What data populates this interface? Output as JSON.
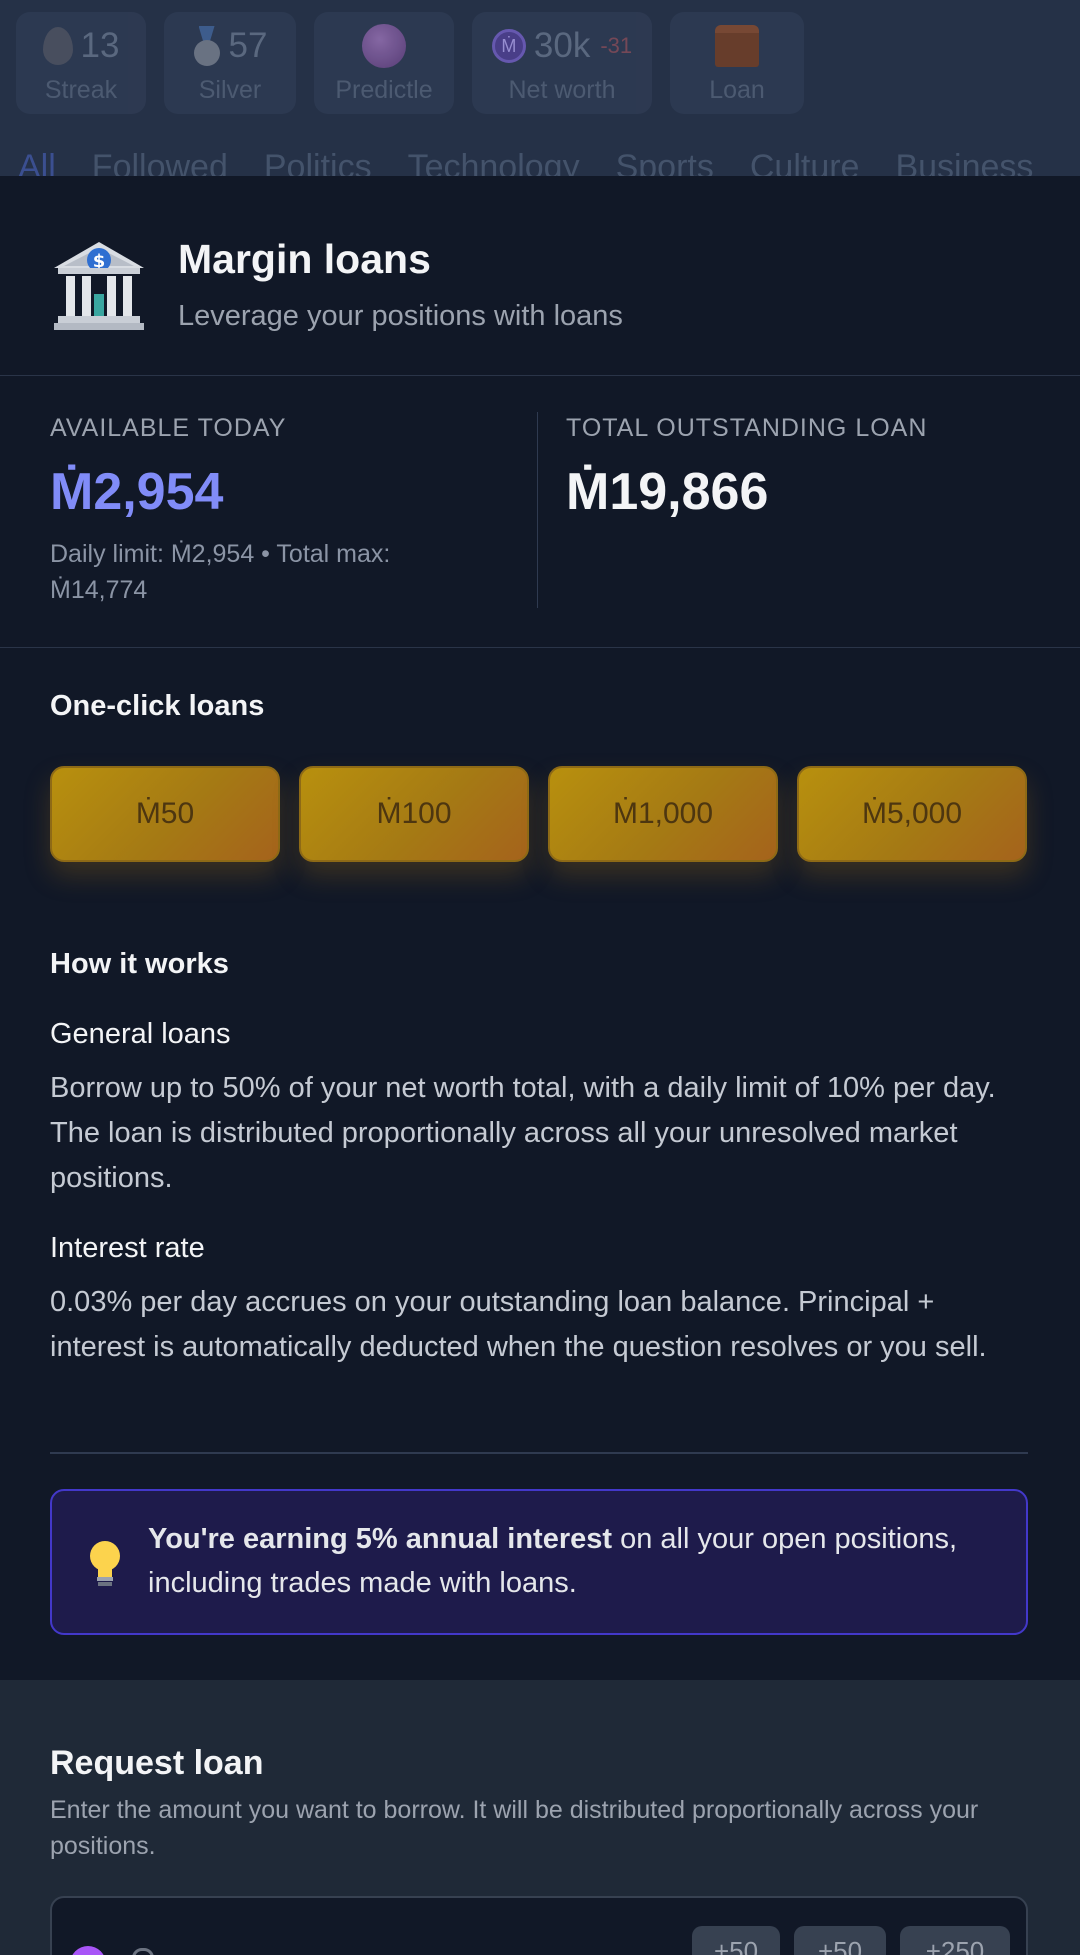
{
  "stats": [
    {
      "value": "13",
      "label": "Streak",
      "icon": "flame-icon"
    },
    {
      "value": "57",
      "label": "Silver",
      "icon": "medal-icon"
    },
    {
      "value": "",
      "label": "Predictle",
      "icon": "crystal-ball-icon"
    },
    {
      "value": "30k",
      "delta": "-31",
      "label": "Net worth",
      "icon": "mana-coin-icon",
      "coin_glyph": "Ṁ"
    },
    {
      "value": "",
      "label": "Loan",
      "icon": "treasure-chest-icon"
    }
  ],
  "categories": [
    "All",
    "Followed",
    "Politics",
    "Technology",
    "Sports",
    "Culture",
    "Business"
  ],
  "modal": {
    "title": "Margin loans",
    "subtitle": "Leverage your positions with loans"
  },
  "available": {
    "caption": "AVAILABLE TODAY",
    "amount": "Ṁ2,954",
    "limits": "Daily limit: Ṁ2,954 • Total max: Ṁ14,774"
  },
  "outstanding": {
    "caption": "TOTAL OUTSTANDING LOAN",
    "amount": "Ṁ19,866"
  },
  "quick": {
    "heading": "One-click loans",
    "buttons": [
      "Ṁ50",
      "Ṁ100",
      "Ṁ1,000",
      "Ṁ5,000"
    ]
  },
  "how": {
    "heading": "How it works",
    "general_title": "General loans",
    "general_text": "Borrow up to 50% of your net worth total, with a daily limit of 10% per day. The loan is distributed proportionally across all your unresolved market positions.",
    "interest_title": "Interest rate",
    "interest_text": "0.03% per day accrues on your outstanding loan balance. Principal + interest is automatically deducted when the question resolves or you sell."
  },
  "note": {
    "bold": "You're earning 5% annual interest",
    "rest": " on all your open positions, including trades made with loans."
  },
  "request": {
    "title": "Request loan",
    "description": "Enter the amount you want to borrow. It will be distributed proportionally across your positions.",
    "chips": [
      "+50",
      "+50",
      "+250"
    ]
  },
  "colors": {
    "accent": "#818cf8",
    "gold": "#b8900e",
    "note_bg": "#1e1b4b",
    "note_border": "#4338ca"
  }
}
